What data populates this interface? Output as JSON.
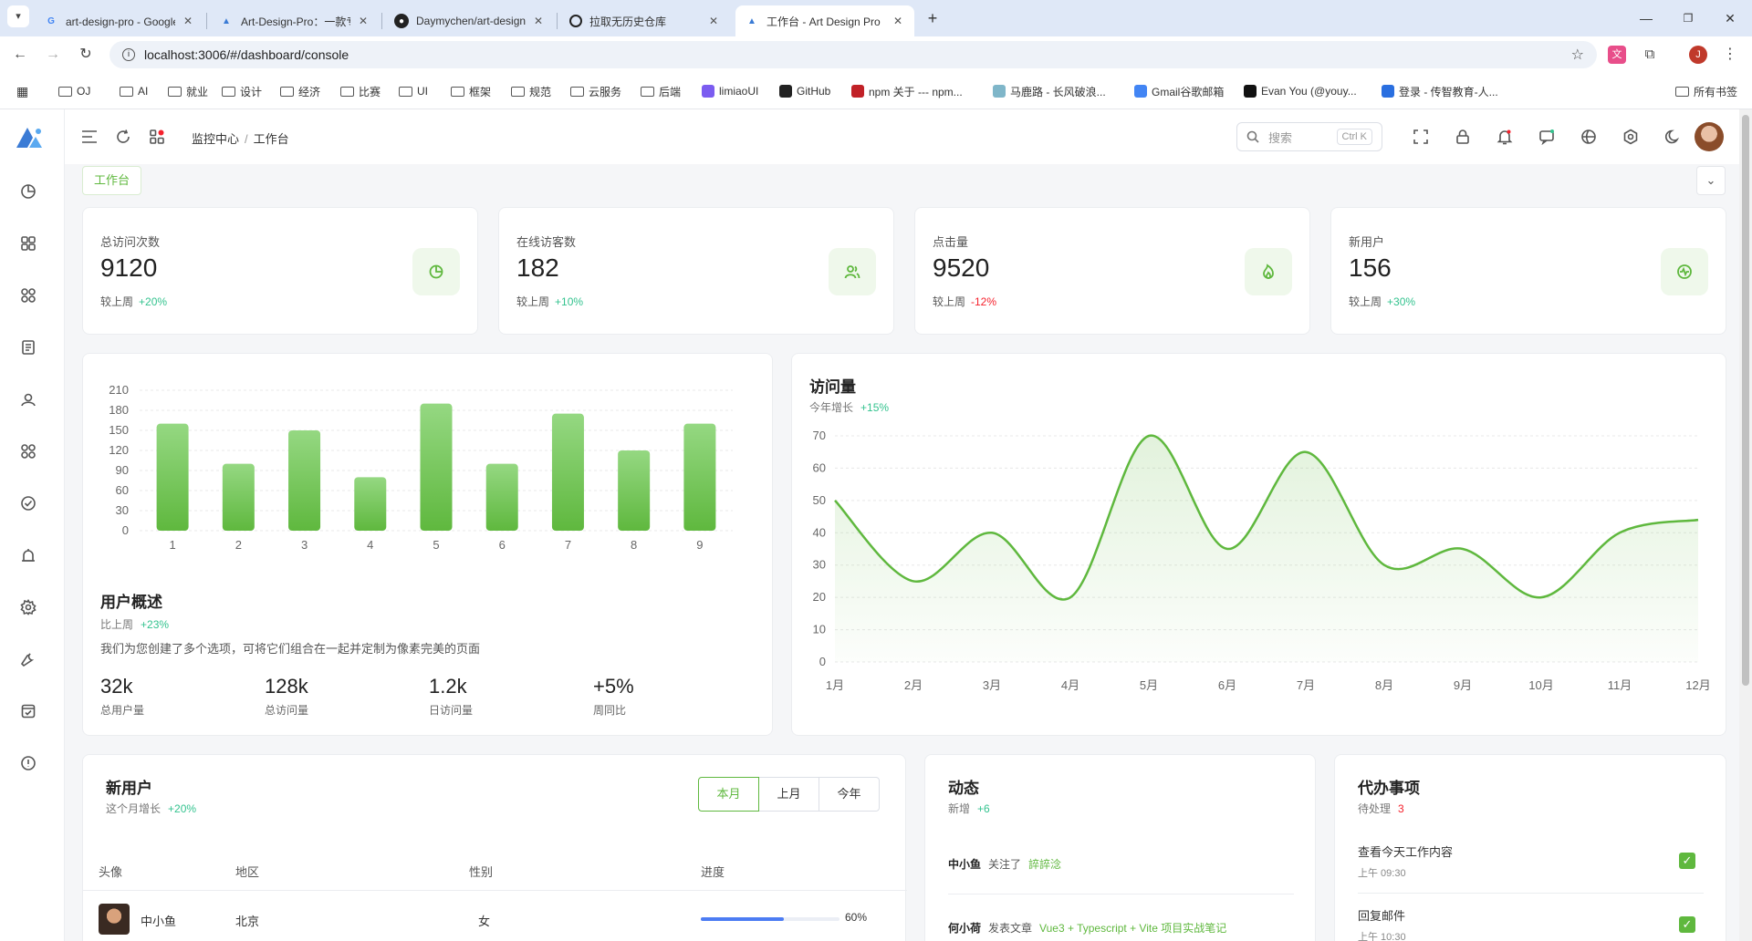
{
  "browser": {
    "tabs": [
      {
        "title": "art-design-pro - Google 搜索",
        "icon": "google-icon",
        "active": false
      },
      {
        "title": "Art-Design-Pro：一款专注于用",
        "icon": "art-design-pro-icon",
        "active": false
      },
      {
        "title": "Daymychen/art-design-pro:",
        "icon": "github-icon",
        "active": false
      },
      {
        "title": "拉取无历史仓库",
        "icon": "openai-icon",
        "active": false
      },
      {
        "title": "工作台 - Art Design Pro",
        "icon": "art-design-pro-icon",
        "active": true
      }
    ],
    "new_tab": "+",
    "url": "localhost:3006/#/dashboard/console",
    "bookmarks": [
      {
        "label": "OJ",
        "type": "folder"
      },
      {
        "label": "AI",
        "type": "folder"
      },
      {
        "label": "就业",
        "type": "folder"
      },
      {
        "label": "设计",
        "type": "folder"
      },
      {
        "label": "经济",
        "type": "folder"
      },
      {
        "label": "比赛",
        "type": "folder"
      },
      {
        "label": "UI",
        "type": "folder"
      },
      {
        "label": "框架",
        "type": "folder"
      },
      {
        "label": "规范",
        "type": "folder"
      },
      {
        "label": "云服务",
        "type": "folder"
      },
      {
        "label": "后端",
        "type": "folder"
      },
      {
        "label": "limiaoUI",
        "type": "site"
      },
      {
        "label": "GitHub",
        "type": "site"
      },
      {
        "label": "npm 关于 --- npm...",
        "type": "site"
      },
      {
        "label": "马鹿路 - 长风破浪...",
        "type": "site"
      },
      {
        "label": "Gmail谷歌邮箱",
        "type": "site"
      },
      {
        "label": "Evan You (@youy...",
        "type": "site"
      },
      {
        "label": "登录 - 传智教育-人...",
        "type": "site"
      }
    ],
    "all_bookmarks": "所有书签",
    "profile_initial": "J"
  },
  "header": {
    "breadcrumb": [
      "监控中心",
      "工作台"
    ],
    "search_placeholder": "搜索",
    "search_shortcut": "Ctrl K"
  },
  "worktab": {
    "label": "工作台"
  },
  "stats": [
    {
      "label": "总访问次数",
      "value": "9120",
      "compare": "较上周",
      "change": "+20%",
      "trend": "up",
      "icon": "pie-chart-icon"
    },
    {
      "label": "在线访客数",
      "value": "182",
      "compare": "较上周",
      "change": "+10%",
      "trend": "up",
      "icon": "users-icon"
    },
    {
      "label": "点击量",
      "value": "9520",
      "compare": "较上周",
      "change": "-12%",
      "trend": "down",
      "icon": "fire-icon"
    },
    {
      "label": "新用户",
      "value": "156",
      "compare": "较上周",
      "change": "+30%",
      "trend": "up",
      "icon": "pulse-icon"
    }
  ],
  "user_overview": {
    "title": "用户概述",
    "subtitle": "比上周",
    "change": "+23%",
    "description": "我们为您创建了多个选项，可将它们组合在一起并定制为像素完美的页面",
    "kpis": [
      {
        "value": "32k",
        "label": "总用户量"
      },
      {
        "value": "128k",
        "label": "总访问量"
      },
      {
        "value": "1.2k",
        "label": "日访问量"
      },
      {
        "value": "+5%",
        "label": "周同比"
      }
    ]
  },
  "visits": {
    "title": "访问量",
    "subtitle": "今年增长",
    "change": "+15%"
  },
  "chart_data": [
    {
      "type": "bar",
      "categories": [
        "1",
        "2",
        "3",
        "4",
        "5",
        "6",
        "7",
        "8",
        "9"
      ],
      "values": [
        160,
        100,
        150,
        80,
        190,
        100,
        175,
        120,
        160
      ],
      "ylim": [
        0,
        210
      ],
      "yticks": [
        0,
        30,
        60,
        90,
        120,
        150,
        180,
        210
      ],
      "grid": true,
      "color": "#5fb83e"
    },
    {
      "type": "area",
      "categories": [
        "1月",
        "2月",
        "3月",
        "4月",
        "5月",
        "6月",
        "7月",
        "8月",
        "9月",
        "10月",
        "11月",
        "12月"
      ],
      "values": [
        50,
        25,
        40,
        20,
        70,
        35,
        65,
        30,
        35,
        20,
        40,
        44
      ],
      "ylim": [
        0,
        70
      ],
      "yticks": [
        0,
        10,
        20,
        30,
        40,
        50,
        60,
        70
      ],
      "grid": true,
      "color": "#5fb83e"
    }
  ],
  "new_users": {
    "title": "新用户",
    "subtitle": "这个月增长",
    "change": "+20%",
    "periods": [
      "本月",
      "上月",
      "今年"
    ],
    "active_period": "本月",
    "columns": [
      "头像",
      "地区",
      "性别",
      "进度"
    ],
    "rows": [
      {
        "name": "中小鱼",
        "region": "北京",
        "gender": "女",
        "progress": 60,
        "progress_label": "60%"
      }
    ]
  },
  "activity": {
    "title": "动态",
    "subtitle": "新增",
    "change": "+6",
    "items": [
      {
        "user": "中小鱼",
        "action": "关注了",
        "target": "誶誶淰"
      },
      {
        "user": "何小荷",
        "action": "发表文章",
        "target": "Vue3 + Typescript + Vite 项目实战笔记"
      }
    ]
  },
  "todos": {
    "title": "代办事项",
    "subtitle": "待处理",
    "count": "3",
    "items": [
      {
        "text": "查看今天工作内容",
        "time": "上午 09:30",
        "done": true
      },
      {
        "text": "回复邮件",
        "time": "上午 10:30",
        "done": true
      }
    ]
  },
  "colors": {
    "accent": "#5fb83e",
    "up": "#34c38f",
    "down": "#f5222d",
    "progress": "#4c7cf3"
  }
}
